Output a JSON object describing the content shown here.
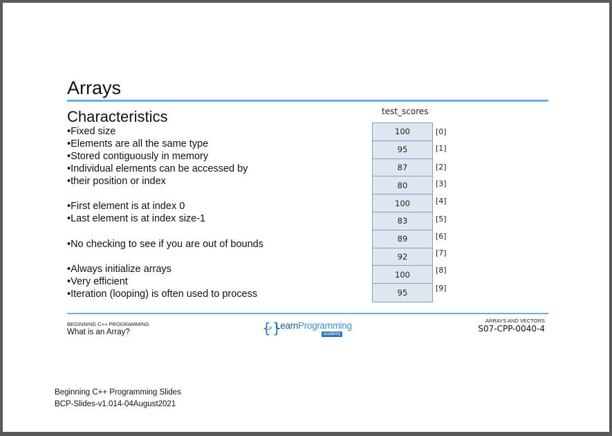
{
  "slide": {
    "title": "Arrays",
    "subtitle": "Characteristics",
    "bullets": [
      "•Fixed size",
      "•Elements are all the same type",
      "•Stored contiguously in memory",
      "•Individual elements can be accessed by",
      "•their position or index",
      "•First element is at index 0",
      "•Last element is at index size-1",
      "•No checking to see if you are out of bounds",
      "•Always initialize arrays",
      "•Very efficient",
      "•Iteration (looping) is often used to process"
    ]
  },
  "array": {
    "name": "test_scores",
    "values": [
      "100",
      "95",
      "87",
      "80",
      "100",
      "83",
      "89",
      "92",
      "100",
      "95"
    ],
    "indices": [
      "[0]",
      "[1]",
      "[2]",
      "[3]",
      "[4]",
      "[5]",
      "[6]",
      "[7]",
      "[8]",
      "[9]"
    ]
  },
  "footer": {
    "left_small": "BEGINNING C++ PROGRAMMING",
    "left_big": "What is an Array?",
    "logo_bracket_left": "{",
    "logo_lp": "LP",
    "logo_bracket_right": "}",
    "logo_learn": "Learn",
    "logo_programming": "Programming",
    "logo_academy": "academy",
    "right_small": "ARRAYS AND VECTORS",
    "right_big": "S07-CPP-0040-4"
  },
  "note": {
    "line1": "Beginning C++ Programming Slides",
    "line2": "BCP-Slides-v1.014-04August2021"
  },
  "colors": {
    "accent_rule": "#6aaee8",
    "array_fill": "#dfe6f0",
    "array_border": "#7f9fc4"
  }
}
